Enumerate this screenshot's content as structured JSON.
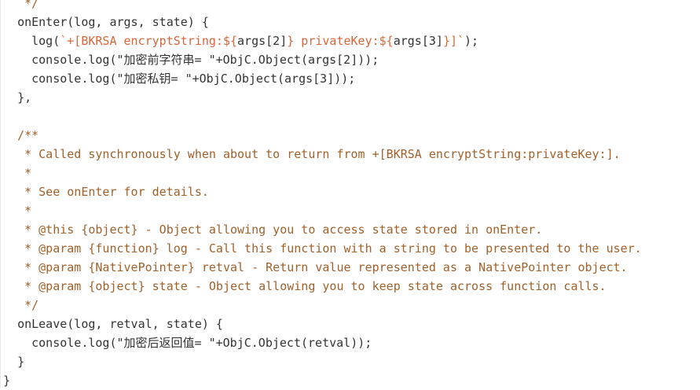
{
  "code": {
    "lines": [
      {
        "indent": "   ",
        "tokens": [
          {
            "type": "comment",
            "text": "*/"
          }
        ]
      },
      {
        "indent": "  ",
        "tokens": [
          {
            "type": "plain",
            "text": "onEnter(log, args, state) {"
          }
        ]
      },
      {
        "indent": "    ",
        "tokens": [
          {
            "type": "plain",
            "text": "log("
          },
          {
            "type": "template",
            "text": "`+[BKRSA encryptString:${"
          },
          {
            "type": "plain",
            "text": "args[2]"
          },
          {
            "type": "template",
            "text": "} privateKey:${"
          },
          {
            "type": "plain",
            "text": "args[3]"
          },
          {
            "type": "template",
            "text": "}]`"
          },
          {
            "type": "plain",
            "text": ");"
          }
        ]
      },
      {
        "indent": "    ",
        "tokens": [
          {
            "type": "plain",
            "text": "console.log(\"加密前字符串= \"+ObjC.Object(args[2]));"
          }
        ]
      },
      {
        "indent": "    ",
        "tokens": [
          {
            "type": "plain",
            "text": "console.log(\"加密私钥= \"+ObjC.Object(args[3]));"
          }
        ]
      },
      {
        "indent": "  ",
        "tokens": [
          {
            "type": "plain",
            "text": "},"
          }
        ]
      },
      {
        "indent": "",
        "tokens": []
      },
      {
        "indent": "  ",
        "tokens": [
          {
            "type": "comment",
            "text": "/**"
          }
        ]
      },
      {
        "indent": "   ",
        "tokens": [
          {
            "type": "comment",
            "text": "* Called synchronously when about to return from +[BKRSA encryptString:privateKey:]."
          }
        ]
      },
      {
        "indent": "   ",
        "tokens": [
          {
            "type": "comment",
            "text": "*"
          }
        ]
      },
      {
        "indent": "   ",
        "tokens": [
          {
            "type": "comment",
            "text": "* See onEnter for details."
          }
        ]
      },
      {
        "indent": "   ",
        "tokens": [
          {
            "type": "comment",
            "text": "*"
          }
        ]
      },
      {
        "indent": "   ",
        "tokens": [
          {
            "type": "comment",
            "text": "* @this {object} - Object allowing you to access state stored in onEnter."
          }
        ]
      },
      {
        "indent": "   ",
        "tokens": [
          {
            "type": "comment",
            "text": "* @param {function} log - Call this function with a string to be presented to the user."
          }
        ]
      },
      {
        "indent": "   ",
        "tokens": [
          {
            "type": "comment",
            "text": "* @param {NativePointer} retval - Return value represented as a NativePointer object."
          }
        ]
      },
      {
        "indent": "   ",
        "tokens": [
          {
            "type": "comment",
            "text": "* @param {object} state - Object allowing you to keep state across function calls."
          }
        ]
      },
      {
        "indent": "   ",
        "tokens": [
          {
            "type": "comment",
            "text": "*/"
          }
        ]
      },
      {
        "indent": "  ",
        "tokens": [
          {
            "type": "plain",
            "text": "onLeave(log, retval, state) {"
          }
        ]
      },
      {
        "indent": "    ",
        "tokens": [
          {
            "type": "plain",
            "text": "console.log(\"加密后返回值= \"+ObjC.Object(retval));"
          }
        ]
      },
      {
        "indent": "  ",
        "tokens": [
          {
            "type": "plain",
            "text": "}"
          }
        ]
      },
      {
        "indent": "",
        "tokens": [
          {
            "type": "plain",
            "text": "}"
          }
        ]
      }
    ]
  },
  "colors": {
    "background": "#ffffff",
    "plain_text": "#333333",
    "comment": "#a0612b",
    "template_string": "#d9663a"
  }
}
